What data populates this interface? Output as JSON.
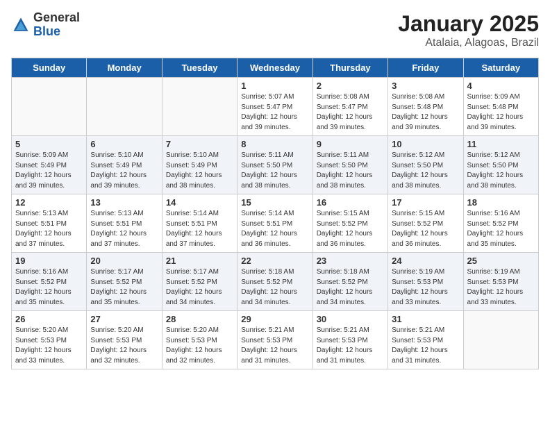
{
  "logo": {
    "general": "General",
    "blue": "Blue"
  },
  "header": {
    "title": "January 2025",
    "subtitle": "Atalaia, Alagoas, Brazil"
  },
  "days_of_week": [
    "Sunday",
    "Monday",
    "Tuesday",
    "Wednesday",
    "Thursday",
    "Friday",
    "Saturday"
  ],
  "weeks": [
    [
      {
        "day": "",
        "info": ""
      },
      {
        "day": "",
        "info": ""
      },
      {
        "day": "",
        "info": ""
      },
      {
        "day": "1",
        "info": "Sunrise: 5:07 AM\nSunset: 5:47 PM\nDaylight: 12 hours\nand 39 minutes."
      },
      {
        "day": "2",
        "info": "Sunrise: 5:08 AM\nSunset: 5:47 PM\nDaylight: 12 hours\nand 39 minutes."
      },
      {
        "day": "3",
        "info": "Sunrise: 5:08 AM\nSunset: 5:48 PM\nDaylight: 12 hours\nand 39 minutes."
      },
      {
        "day": "4",
        "info": "Sunrise: 5:09 AM\nSunset: 5:48 PM\nDaylight: 12 hours\nand 39 minutes."
      }
    ],
    [
      {
        "day": "5",
        "info": "Sunrise: 5:09 AM\nSunset: 5:49 PM\nDaylight: 12 hours\nand 39 minutes."
      },
      {
        "day": "6",
        "info": "Sunrise: 5:10 AM\nSunset: 5:49 PM\nDaylight: 12 hours\nand 39 minutes."
      },
      {
        "day": "7",
        "info": "Sunrise: 5:10 AM\nSunset: 5:49 PM\nDaylight: 12 hours\nand 38 minutes."
      },
      {
        "day": "8",
        "info": "Sunrise: 5:11 AM\nSunset: 5:50 PM\nDaylight: 12 hours\nand 38 minutes."
      },
      {
        "day": "9",
        "info": "Sunrise: 5:11 AM\nSunset: 5:50 PM\nDaylight: 12 hours\nand 38 minutes."
      },
      {
        "day": "10",
        "info": "Sunrise: 5:12 AM\nSunset: 5:50 PM\nDaylight: 12 hours\nand 38 minutes."
      },
      {
        "day": "11",
        "info": "Sunrise: 5:12 AM\nSunset: 5:50 PM\nDaylight: 12 hours\nand 38 minutes."
      }
    ],
    [
      {
        "day": "12",
        "info": "Sunrise: 5:13 AM\nSunset: 5:51 PM\nDaylight: 12 hours\nand 37 minutes."
      },
      {
        "day": "13",
        "info": "Sunrise: 5:13 AM\nSunset: 5:51 PM\nDaylight: 12 hours\nand 37 minutes."
      },
      {
        "day": "14",
        "info": "Sunrise: 5:14 AM\nSunset: 5:51 PM\nDaylight: 12 hours\nand 37 minutes."
      },
      {
        "day": "15",
        "info": "Sunrise: 5:14 AM\nSunset: 5:51 PM\nDaylight: 12 hours\nand 36 minutes."
      },
      {
        "day": "16",
        "info": "Sunrise: 5:15 AM\nSunset: 5:52 PM\nDaylight: 12 hours\nand 36 minutes."
      },
      {
        "day": "17",
        "info": "Sunrise: 5:15 AM\nSunset: 5:52 PM\nDaylight: 12 hours\nand 36 minutes."
      },
      {
        "day": "18",
        "info": "Sunrise: 5:16 AM\nSunset: 5:52 PM\nDaylight: 12 hours\nand 35 minutes."
      }
    ],
    [
      {
        "day": "19",
        "info": "Sunrise: 5:16 AM\nSunset: 5:52 PM\nDaylight: 12 hours\nand 35 minutes."
      },
      {
        "day": "20",
        "info": "Sunrise: 5:17 AM\nSunset: 5:52 PM\nDaylight: 12 hours\nand 35 minutes."
      },
      {
        "day": "21",
        "info": "Sunrise: 5:17 AM\nSunset: 5:52 PM\nDaylight: 12 hours\nand 34 minutes."
      },
      {
        "day": "22",
        "info": "Sunrise: 5:18 AM\nSunset: 5:52 PM\nDaylight: 12 hours\nand 34 minutes."
      },
      {
        "day": "23",
        "info": "Sunrise: 5:18 AM\nSunset: 5:52 PM\nDaylight: 12 hours\nand 34 minutes."
      },
      {
        "day": "24",
        "info": "Sunrise: 5:19 AM\nSunset: 5:53 PM\nDaylight: 12 hours\nand 33 minutes."
      },
      {
        "day": "25",
        "info": "Sunrise: 5:19 AM\nSunset: 5:53 PM\nDaylight: 12 hours\nand 33 minutes."
      }
    ],
    [
      {
        "day": "26",
        "info": "Sunrise: 5:20 AM\nSunset: 5:53 PM\nDaylight: 12 hours\nand 33 minutes."
      },
      {
        "day": "27",
        "info": "Sunrise: 5:20 AM\nSunset: 5:53 PM\nDaylight: 12 hours\nand 32 minutes."
      },
      {
        "day": "28",
        "info": "Sunrise: 5:20 AM\nSunset: 5:53 PM\nDaylight: 12 hours\nand 32 minutes."
      },
      {
        "day": "29",
        "info": "Sunrise: 5:21 AM\nSunset: 5:53 PM\nDaylight: 12 hours\nand 31 minutes."
      },
      {
        "day": "30",
        "info": "Sunrise: 5:21 AM\nSunset: 5:53 PM\nDaylight: 12 hours\nand 31 minutes."
      },
      {
        "day": "31",
        "info": "Sunrise: 5:21 AM\nSunset: 5:53 PM\nDaylight: 12 hours\nand 31 minutes."
      },
      {
        "day": "",
        "info": ""
      }
    ]
  ]
}
